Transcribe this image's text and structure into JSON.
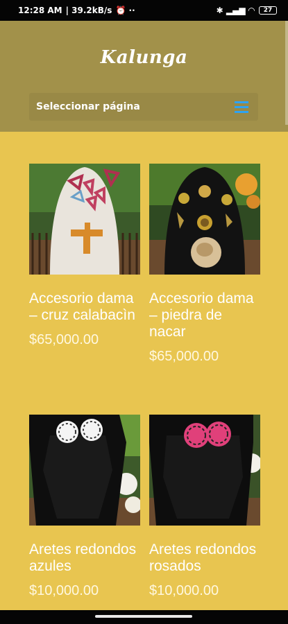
{
  "status_bar": {
    "time": "12:28 AM",
    "speed": "| 39.2kB/s",
    "extra": "⏰ ··",
    "icons": "✱ ▂▄▆ ◠",
    "battery": "27"
  },
  "header": {
    "logo": "Kalunga",
    "page_select_label": "Seleccionar página"
  },
  "products": [
    {
      "title": "Accesorio dama – cruz calabacìn",
      "price": "$65,000.00",
      "image_icon": "necklace-cross-image"
    },
    {
      "title": "Accesorio dama – piedra de nacar",
      "price": "$65,000.00",
      "image_icon": "necklace-shell-image"
    },
    {
      "title": "Aretes redondos azules",
      "price": "$10,000.00",
      "image_icon": "earrings-blue-image"
    },
    {
      "title": "Aretes redondos rosados",
      "price": "$10,000.00",
      "image_icon": "earrings-pink-image"
    }
  ],
  "colors": {
    "header_bg": "#a2914a",
    "page_bg": "#e8c550",
    "menu_icon": "#2ea3f2"
  }
}
